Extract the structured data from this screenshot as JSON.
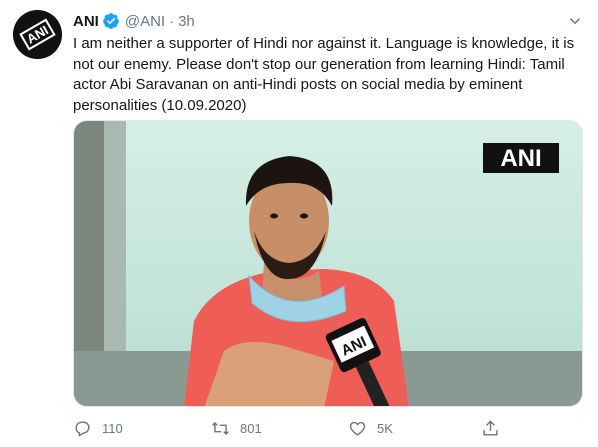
{
  "tweet": {
    "author_name": "ANI",
    "author_handle": "@ANI",
    "separator": "·",
    "timestamp": "3h",
    "text": "I am neither a supporter of Hindi nor against it. Language is knowledge, it is not our enemy. Please don't stop our generation from learning Hindi: Tamil actor Abi Saravanan on anti-Hindi posts on social media by eminent personalities (10.09.2020)",
    "avatar_logo": "ANI",
    "media_watermark": "ANI",
    "mic_logo": "ANI"
  },
  "actions": {
    "reply_count": "110",
    "retweet_count": "801",
    "like_count": "5K"
  },
  "icons": {
    "verified": "verified-badge-icon",
    "caret": "chevron-down-icon",
    "reply": "reply-icon",
    "retweet": "retweet-icon",
    "like": "heart-icon",
    "share": "share-icon"
  },
  "colors": {
    "verified_blue": "#1da1f2",
    "secondary_text": "#657786",
    "primary_text": "#14171a"
  }
}
